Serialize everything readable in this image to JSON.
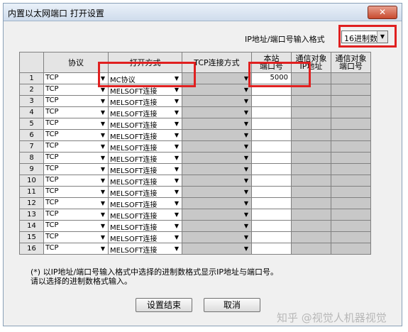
{
  "window": {
    "title": "内置以太网端口 打开设置",
    "close_label": "✕"
  },
  "format": {
    "label": "IP地址/端口号输入格式",
    "selected": "16进制数"
  },
  "table": {
    "headers": [
      "协议",
      "打开方式",
      "TCP连接方式",
      "本站\n端口号",
      "通信对象\nIP地址",
      "通信对象\n端口号"
    ],
    "rows": [
      {
        "num": "1",
        "protocol": "TCP",
        "open_method": "MC协议",
        "port": "5000"
      },
      {
        "num": "2",
        "protocol": "TCP",
        "open_method": "MELSOFT连接",
        "port": ""
      },
      {
        "num": "3",
        "protocol": "TCP",
        "open_method": "MELSOFT连接",
        "port": ""
      },
      {
        "num": "4",
        "protocol": "TCP",
        "open_method": "MELSOFT连接",
        "port": ""
      },
      {
        "num": "5",
        "protocol": "TCP",
        "open_method": "MELSOFT连接",
        "port": ""
      },
      {
        "num": "6",
        "protocol": "TCP",
        "open_method": "MELSOFT连接",
        "port": ""
      },
      {
        "num": "7",
        "protocol": "TCP",
        "open_method": "MELSOFT连接",
        "port": ""
      },
      {
        "num": "8",
        "protocol": "TCP",
        "open_method": "MELSOFT连接",
        "port": ""
      },
      {
        "num": "9",
        "protocol": "TCP",
        "open_method": "MELSOFT连接",
        "port": ""
      },
      {
        "num": "10",
        "protocol": "TCP",
        "open_method": "MELSOFT连接",
        "port": ""
      },
      {
        "num": "11",
        "protocol": "TCP",
        "open_method": "MELSOFT连接",
        "port": ""
      },
      {
        "num": "12",
        "protocol": "TCP",
        "open_method": "MELSOFT连接",
        "port": ""
      },
      {
        "num": "13",
        "protocol": "TCP",
        "open_method": "MELSOFT连接",
        "port": ""
      },
      {
        "num": "14",
        "protocol": "TCP",
        "open_method": "MELSOFT连接",
        "port": ""
      },
      {
        "num": "15",
        "protocol": "TCP",
        "open_method": "MELSOFT连接",
        "port": ""
      },
      {
        "num": "16",
        "protocol": "TCP",
        "open_method": "MELSOFT连接",
        "port": ""
      }
    ]
  },
  "note": {
    "line1": "(*) 以IP地址/端口号输入格式中选择的进制数格式显示IP地址与端口号。",
    "line2": "请以选择的进制数格式输入。"
  },
  "buttons": {
    "ok": "设置结束",
    "cancel": "取消"
  },
  "watermark": "知乎 @视觉人机器视觉",
  "colors": {
    "highlight": "#e02020",
    "grid_gray": "#c8c8c8",
    "header_bg": "#e4e4e4"
  }
}
